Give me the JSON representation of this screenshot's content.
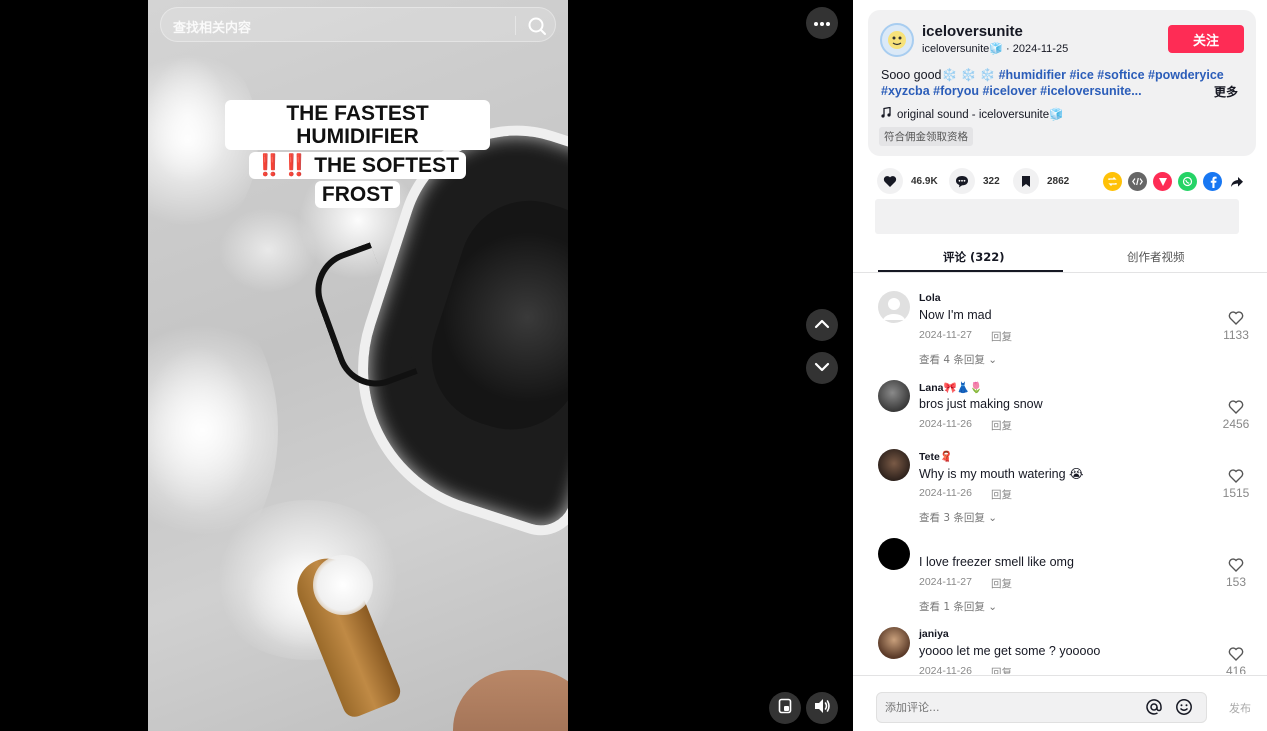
{
  "video": {
    "search_placeholder": "查找相关内容",
    "caption_line1": "THE FASTEST HUMIDIFIER",
    "caption_em": "‼️‼️",
    "caption_line2": " THE SOFTEST",
    "caption_line3": "FROST",
    "more_icon": "more-icon",
    "prev_icon": "chevron-up-icon",
    "next_icon": "chevron-down-icon",
    "pip_icon": "picture-in-picture-icon",
    "volume_icon": "volume-icon"
  },
  "post": {
    "author_name": "iceloversunite",
    "author_handle": "iceloversunite🧊",
    "date_sep": " · ",
    "date": "2024-11-25",
    "follow_label": "关注",
    "description_prefix": "Sooo good❄️ ❄️ ❄️ ",
    "hashtags": [
      "#humidifier",
      "#ice",
      "#softice",
      "#powderyice",
      "#xyzcba",
      "#foryou",
      "#icelover",
      "#iceloversunite..."
    ],
    "more_label": "更多",
    "music": "original sound - iceloversunite🧊",
    "commission_label": "符合佣金领取资格"
  },
  "actions": {
    "likes": "46.9K",
    "comments": "322",
    "saves": "2862",
    "share_targets": [
      "repost-icon",
      "embed-icon",
      "send-icon",
      "whatsapp-icon",
      "facebook-icon",
      "share-arrow-icon"
    ]
  },
  "tabs": {
    "comments_label": "评论 (322)",
    "creator_label": "创作者视频"
  },
  "comments": [
    {
      "user": "Lola",
      "text": "Now I'm mad",
      "date": "2024-11-27",
      "reply": "回复",
      "likes": "1133",
      "view_replies": "查看 4 条回复 ⌄"
    },
    {
      "user": "Lana🎀👗🌷",
      "text": "bros just making snow",
      "date": "2024-11-26",
      "reply": "回复",
      "likes": "2456",
      "view_replies": ""
    },
    {
      "user": "Tete🧣",
      "text": "Why is my mouth watering 😭",
      "date": "2024-11-26",
      "reply": "回复",
      "likes": "1515",
      "view_replies": "查看 3 条回复 ⌄"
    },
    {
      "user": " ",
      "text": "I love freezer smell like omg",
      "date": "2024-11-27",
      "reply": "回复",
      "likes": "153",
      "view_replies": "查看 1 条回复 ⌄"
    },
    {
      "user": "janiya",
      "text": "yoooo let me get some ? yooooo",
      "date": "2024-11-26",
      "reply": "回复",
      "likes": "416",
      "view_replies": ""
    }
  ],
  "comment_bar": {
    "placeholder": "添加评论...",
    "post_label": "发布"
  },
  "colors": {
    "follow": "#fe2c55",
    "hashtag": "#2b5db9",
    "repost": "#ffc107",
    "embed": "#666666",
    "send": "#fe2c55",
    "whatsapp": "#25d366",
    "facebook": "#1877f2"
  }
}
